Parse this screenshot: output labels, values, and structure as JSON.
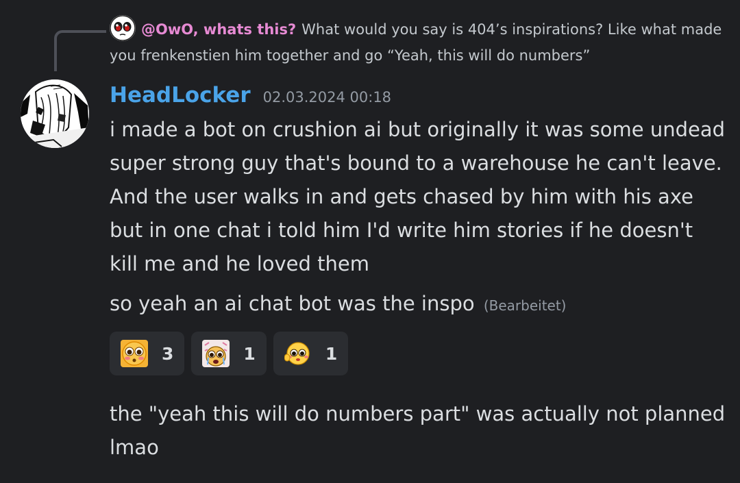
{
  "reply": {
    "author": "@OwO, whats this?",
    "text": "What would you say is 404’s inspirations? Like what made you frenkenstien him together and go “Yeah, this will do numbers”"
  },
  "message": {
    "author": "HeadLocker",
    "timestamp": "02.03.2024 00:18",
    "author_color": "#4aa3e8",
    "body_1": "i made a bot on crushion ai but originally it was some undead super strong guy that's bound to a warehouse he can't leave. And the user walks in and gets chased by him with his axe but in one chat i told him I'd write him stories if he doesn't kill me and he loved them",
    "body_2": "so yeah an ai chat bot was the inspo",
    "edited_label": "(Bearbeitet)",
    "body_3": "the \"yeah this will do numbers part\" was actually not planned lmao"
  },
  "reactions": [
    {
      "emoji": "flushed-pleading-emoji",
      "count": "3"
    },
    {
      "emoji": "crying-pleading-emoji",
      "count": "1"
    },
    {
      "emoji": "shy-blush-emoji",
      "count": "1"
    }
  ],
  "colors": {
    "background": "#1e1f22",
    "reply_author": "#e68ad3",
    "reaction_bg": "#2b2d31"
  }
}
